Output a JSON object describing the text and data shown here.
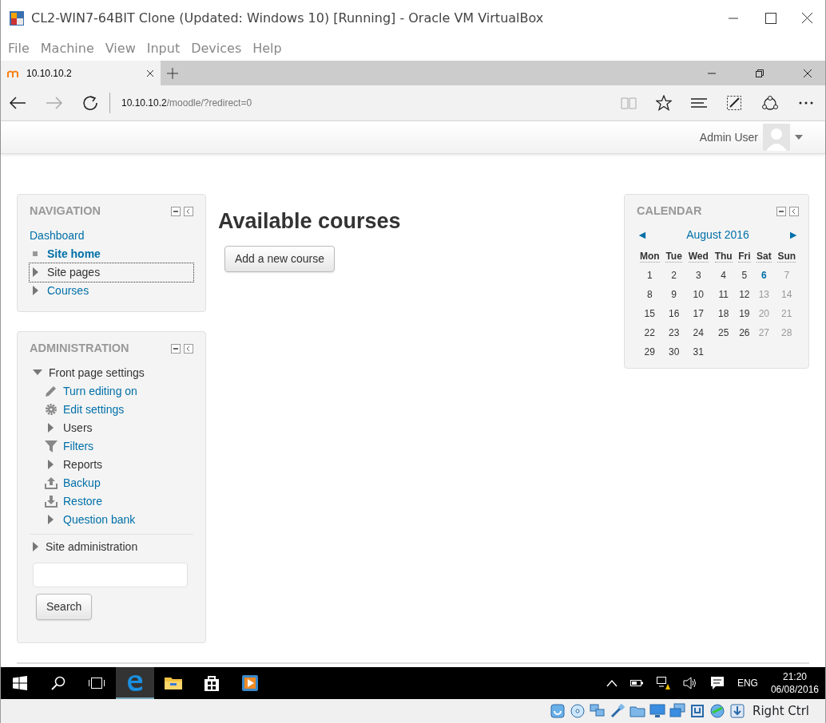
{
  "window": {
    "title": "CL2-WIN7-64BIT Clone (Updated: Windows 10) [Running] - Oracle VM VirtualBox"
  },
  "menu": [
    "File",
    "Machine",
    "View",
    "Input",
    "Devices",
    "Help"
  ],
  "browser": {
    "tab": "10.10.10.2",
    "url_host": "10.10.10.2",
    "url_path": "/moodle/?redirect=0"
  },
  "header": {
    "user": "Admin User"
  },
  "navigation": {
    "title": "NAVIGATION",
    "items": [
      {
        "label": "Dashboard",
        "kind": "link",
        "focused": false
      },
      {
        "label": "Site home",
        "kind": "current",
        "focused": false
      },
      {
        "label": "Site pages",
        "kind": "branch",
        "focused": true
      },
      {
        "label": "Courses",
        "kind": "branchlink",
        "focused": false
      }
    ]
  },
  "administration": {
    "title": "ADMINISTRATION",
    "tree": [
      {
        "label": "Front page settings",
        "expanded": true,
        "children": [
          {
            "label": "Turn editing on",
            "kind": "pencil"
          },
          {
            "label": "Edit settings",
            "kind": "gear"
          },
          {
            "label": "Users",
            "kind": "branch"
          },
          {
            "label": "Filters",
            "kind": "filter"
          },
          {
            "label": "Reports",
            "kind": "branch"
          },
          {
            "label": "Backup",
            "kind": "upload"
          },
          {
            "label": "Restore",
            "kind": "download"
          },
          {
            "label": "Question bank",
            "kind": "branchlink"
          }
        ]
      },
      {
        "label": "Site administration",
        "expanded": false
      }
    ],
    "search_button": "Search"
  },
  "main": {
    "heading": "Available courses",
    "button": "Add a new course"
  },
  "calendar": {
    "title": "CALENDAR",
    "prev": "◄",
    "month": "August 2016",
    "next": "►",
    "weekdays": [
      "Mon",
      "Tue",
      "Wed",
      "Thu",
      "Fri",
      "Sat",
      "Sun"
    ],
    "weeks": [
      [
        {
          "day": "1",
          "kind": "weekday"
        },
        {
          "day": "2",
          "kind": "weekday"
        },
        {
          "day": "3",
          "kind": "weekday"
        },
        {
          "day": "4",
          "kind": "weekday"
        },
        {
          "day": "5",
          "kind": "weekday"
        },
        {
          "day": "6",
          "kind": "today"
        },
        {
          "day": "7",
          "kind": "weekend"
        }
      ],
      [
        {
          "day": "8",
          "kind": "weekday"
        },
        {
          "day": "9",
          "kind": "weekday"
        },
        {
          "day": "10",
          "kind": "weekday"
        },
        {
          "day": "11",
          "kind": "weekday"
        },
        {
          "day": "12",
          "kind": "weekday"
        },
        {
          "day": "13",
          "kind": "weekend"
        },
        {
          "day": "14",
          "kind": "weekend"
        }
      ],
      [
        {
          "day": "15",
          "kind": "weekday"
        },
        {
          "day": "16",
          "kind": "weekday"
        },
        {
          "day": "17",
          "kind": "weekday"
        },
        {
          "day": "18",
          "kind": "weekday"
        },
        {
          "day": "19",
          "kind": "weekday"
        },
        {
          "day": "20",
          "kind": "weekend"
        },
        {
          "day": "21",
          "kind": "weekend"
        }
      ],
      [
        {
          "day": "22",
          "kind": "weekday"
        },
        {
          "day": "23",
          "kind": "weekday"
        },
        {
          "day": "24",
          "kind": "weekday"
        },
        {
          "day": "25",
          "kind": "weekday"
        },
        {
          "day": "26",
          "kind": "weekday"
        },
        {
          "day": "27",
          "kind": "weekend"
        },
        {
          "day": "28",
          "kind": "weekend"
        }
      ],
      [
        {
          "day": "29",
          "kind": "weekday"
        },
        {
          "day": "30",
          "kind": "weekday"
        },
        {
          "day": "31",
          "kind": "weekday"
        }
      ]
    ]
  },
  "taskbar": {
    "language": "ENG",
    "time": "21:20",
    "date": "06/08/2016"
  },
  "status_bar": {
    "host_key": "Right Ctrl"
  }
}
